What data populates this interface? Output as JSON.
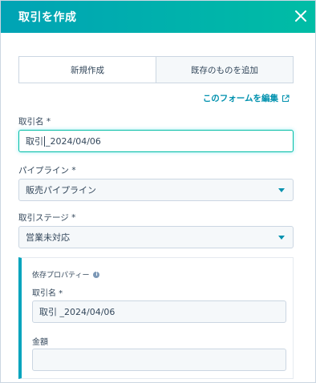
{
  "header": {
    "title": "取引を作成",
    "close_icon": "close-icon"
  },
  "tabs": [
    {
      "label": "新規作成",
      "active": true
    },
    {
      "label": "既存のものを追加",
      "active": false
    }
  ],
  "edit_form_link": {
    "label": "このフォームを編集",
    "icon": "external-link-icon"
  },
  "fields": {
    "deal_name": {
      "label": "取引名 *",
      "value_before_caret": "取引",
      "value_after_caret": "_2024/04/06"
    },
    "pipeline": {
      "label": "パイプライン *",
      "value": "販売パイプライン"
    },
    "deal_stage": {
      "label": "取引ステージ *",
      "value": "営業未対応"
    }
  },
  "dependent": {
    "title": "依存プロパティー",
    "deal_name_label": "取引名 *",
    "deal_name_value": "取引 _2024/04/06",
    "amount_label": "金額",
    "amount_value": ""
  },
  "colors": {
    "header_start": "#00a3b5",
    "header_end": "#00bda5",
    "accent": "#0091ae",
    "dependent_bar": "#00a4bd"
  }
}
